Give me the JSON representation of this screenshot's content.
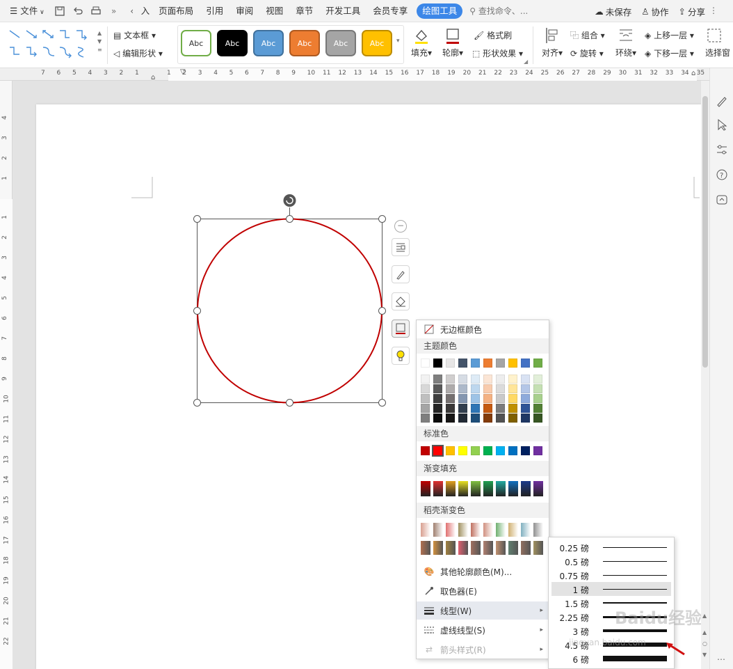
{
  "menubar": {
    "file": "文件",
    "tabs": [
      "页面布局",
      "引用",
      "审阅",
      "视图",
      "章节",
      "开发工具",
      "会员专享"
    ],
    "active_tab": "绘图工具",
    "search_placeholder": "查找命令、...",
    "unsaved": "未保存",
    "collab": "协作",
    "share": "分享"
  },
  "ribbon": {
    "textbox": "文本框",
    "edit_shape": "编辑形状",
    "style_samples": [
      {
        "label": "Abc",
        "bg": "#ffffff",
        "fg": "#333333",
        "border": "#70ad47"
      },
      {
        "label": "Abc",
        "bg": "#000000",
        "fg": "#ffffff",
        "border": "#000000"
      },
      {
        "label": "Abc",
        "bg": "#5b9bd5",
        "fg": "#ffffff",
        "border": "#41719c"
      },
      {
        "label": "Abc",
        "bg": "#ed7d31",
        "fg": "#ffffff",
        "border": "#ae5a21"
      },
      {
        "label": "Abc",
        "bg": "#a5a5a5",
        "fg": "#ffffff",
        "border": "#787878"
      },
      {
        "label": "Abc",
        "bg": "#ffc000",
        "fg": "#ffffff",
        "border": "#bc8c00"
      }
    ],
    "fill": "填充",
    "outline": "轮廓",
    "format_painter": "格式刷",
    "shape_effect": "形状效果",
    "align": "对齐",
    "group": "组合",
    "rotate": "旋转",
    "wrap": "环绕",
    "bring_forward": "上移一层",
    "send_backward": "下移一层",
    "selection_pane": "选择窗"
  },
  "ruler": {
    "h_left": [
      "7",
      "6",
      "5",
      "4",
      "3",
      "2",
      "1"
    ],
    "h_right": [
      "1",
      "2",
      "3",
      "4",
      "5",
      "6",
      "7",
      "8",
      "9",
      "10",
      "11",
      "12",
      "13",
      "14",
      "15",
      "16",
      "17",
      "18",
      "19",
      "20",
      "21",
      "22",
      "23",
      "24",
      "25",
      "26",
      "27",
      "28",
      "29",
      "30",
      "31",
      "32",
      "33",
      "34",
      "35"
    ],
    "v_top": [
      "4",
      "3",
      "2",
      "1"
    ],
    "v_main": [
      "1",
      "2",
      "3",
      "4",
      "5",
      "6",
      "7",
      "8",
      "9",
      "10",
      "11",
      "12",
      "13",
      "14",
      "15",
      "16",
      "17",
      "18",
      "19",
      "20",
      "21",
      "22"
    ]
  },
  "shape": {
    "outline_color": "#c00000"
  },
  "outline_menu": {
    "no_border": "无边框颜色",
    "theme_colors_title": "主题颜色",
    "theme_top": [
      "#ffffff",
      "#000000",
      "#e7e6e6",
      "#44546a",
      "#5b9bd5",
      "#ed7d31",
      "#a5a5a5",
      "#ffc000",
      "#4472c4",
      "#70ad47"
    ],
    "theme_shades": [
      [
        "#f2f2f2",
        "#7f7f7f",
        "#d0cece",
        "#d6dce4",
        "#deebf6",
        "#fbe5d5",
        "#ededed",
        "#fff2cc",
        "#d9e2f3",
        "#e2efd9"
      ],
      [
        "#d8d8d8",
        "#595959",
        "#aeabab",
        "#adb9ca",
        "#bdd7ee",
        "#f8cbad",
        "#dbdbdb",
        "#ffe599",
        "#b4c6e7",
        "#c5e0b3"
      ],
      [
        "#bfbfbf",
        "#3f3f3f",
        "#757070",
        "#8496b0",
        "#9dc3e6",
        "#f4b183",
        "#c9c9c9",
        "#ffd965",
        "#8eaadb",
        "#a8d08d"
      ],
      [
        "#a5a5a5",
        "#262626",
        "#3a3838",
        "#323f4f",
        "#2e75b5",
        "#c55a11",
        "#7b7b7b",
        "#bf9000",
        "#2f5496",
        "#538135"
      ],
      [
        "#7f7f7f",
        "#0c0c0c",
        "#171616",
        "#222a35",
        "#1e4e79",
        "#833c0b",
        "#525252",
        "#7f6000",
        "#1f3864",
        "#375623"
      ]
    ],
    "standard_title": "标准色",
    "standard": [
      "#c00000",
      "#ff0000",
      "#ffc000",
      "#ffff00",
      "#92d050",
      "#00b050",
      "#00b0f0",
      "#0070c0",
      "#002060",
      "#7030a0"
    ],
    "gradient_title": "渐变填充",
    "gradient": [
      "#c00000",
      "#e03030",
      "#e0a020",
      "#e8e020",
      "#80c040",
      "#20a050",
      "#20a8a0",
      "#1070c0",
      "#1a3a8a",
      "#7030a0"
    ],
    "wps_gradient_title": "稻壳渐变色",
    "wps_gradient_row1": [
      "#d9a090",
      "#a08070",
      "#e07070",
      "#a09060",
      "#c07060",
      "#d09080",
      "#70b070",
      "#d0b070",
      "#80b0c0",
      "#909090"
    ],
    "wps_gradient_row2": [
      "#b07050",
      "#d09040",
      "#a08040",
      "#e06070",
      "#a07060",
      "#b08070",
      "#c09070",
      "#608070",
      "#907060",
      "#a09060"
    ],
    "more_colors": "其他轮廓颜色(M)...",
    "eyedropper": "取色器(E)",
    "line_type": "线型(W)",
    "dash_type": "虚线线型(S)",
    "arrow_style": "箭头样式(R)"
  },
  "line_weights": [
    {
      "label": "0.25 磅",
      "pt": 0.25
    },
    {
      "label": "0.5 磅",
      "pt": 0.5
    },
    {
      "label": "0.75 磅",
      "pt": 0.75
    },
    {
      "label": "1 磅",
      "pt": 1
    },
    {
      "label": "1.5 磅",
      "pt": 1.5
    },
    {
      "label": "2.25 磅",
      "pt": 2.25
    },
    {
      "label": "3 磅",
      "pt": 3
    },
    {
      "label": "4.5 磅",
      "pt": 4.5
    },
    {
      "label": "6 磅",
      "pt": 6
    }
  ],
  "watermark": {
    "text1": "Baidu 经验",
    "text2": "jingyan.baidu.com"
  }
}
